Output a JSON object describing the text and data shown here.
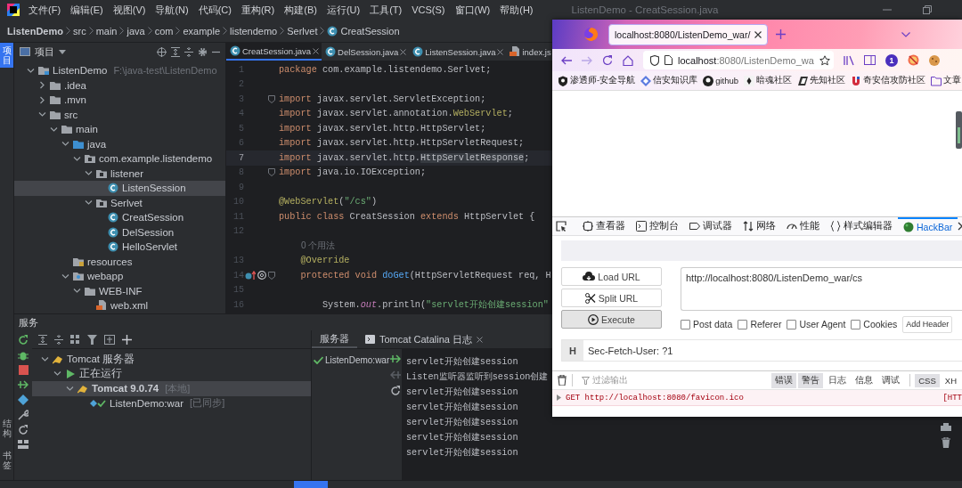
{
  "ide": {
    "title": "ListenDemo - CreatSession.java",
    "menu": [
      "文件(F)",
      "编辑(E)",
      "视图(V)",
      "导航(N)",
      "代码(C)",
      "重构(R)",
      "构建(B)",
      "运行(U)",
      "工具(T)",
      "VCS(S)",
      "窗口(W)",
      "帮助(H)"
    ],
    "breadcrumb": [
      {
        "label": "ListenDemo",
        "kind": "project"
      },
      {
        "label": "src",
        "kind": "folder"
      },
      {
        "label": "main",
        "kind": "folder"
      },
      {
        "label": "java",
        "kind": "folder"
      },
      {
        "label": "com",
        "kind": "folder"
      },
      {
        "label": "example",
        "kind": "folder"
      },
      {
        "label": "listendemo",
        "kind": "folder"
      },
      {
        "label": "Serlvet",
        "kind": "folder"
      },
      {
        "label": "CreatSession",
        "kind": "class"
      }
    ],
    "left_stripe": [
      {
        "label": "项目",
        "selected": true,
        "kind": "top"
      },
      {
        "label": "结构",
        "selected": false,
        "kind": "bottom"
      },
      {
        "label": "书签",
        "selected": false,
        "kind": "bottom"
      }
    ],
    "project_panel": {
      "title": "项目",
      "tree": [
        {
          "label": "ListenDemo",
          "note": "F:\\java-test\\ListenDemo",
          "kind": "module",
          "expanded": true,
          "selected": false,
          "children": [
            {
              "label": ".idea",
              "kind": "folder",
              "expanded": false,
              "selected": false
            },
            {
              "label": ".mvn",
              "kind": "folder",
              "expanded": false,
              "selected": false
            },
            {
              "label": "src",
              "kind": "folder",
              "expanded": true,
              "selected": false,
              "children": [
                {
                  "label": "main",
                  "kind": "folder",
                  "expanded": true,
                  "selected": false,
                  "children": [
                    {
                      "label": "java",
                      "kind": "source",
                      "expanded": true,
                      "selected": false,
                      "children": [
                        {
                          "label": "com.example.listendemo",
                          "kind": "package",
                          "expanded": true,
                          "selected": false,
                          "children": [
                            {
                              "label": "listener",
                              "kind": "package",
                              "expanded": true,
                              "selected": false,
                              "children": [
                                {
                                  "label": "ListenSession",
                                  "kind": "class",
                                  "selected": true
                                }
                              ]
                            },
                            {
                              "label": "Serlvet",
                              "kind": "package",
                              "expanded": true,
                              "selected": false,
                              "children": [
                                {
                                  "label": "CreatSession",
                                  "kind": "class",
                                  "selected": false
                                },
                                {
                                  "label": "DelSession",
                                  "kind": "class",
                                  "selected": false
                                },
                                {
                                  "label": "HelloServlet",
                                  "kind": "class",
                                  "selected": false
                                }
                              ]
                            }
                          ]
                        }
                      ]
                    },
                    {
                      "label": "resources",
                      "kind": "resources",
                      "selected": false
                    },
                    {
                      "label": "webapp",
                      "kind": "web",
                      "expanded": true,
                      "selected": false,
                      "children": [
                        {
                          "label": "WEB-INF",
                          "kind": "folder",
                          "expanded": true,
                          "selected": false,
                          "children": [
                            {
                              "label": "web.xml",
                              "kind": "xml",
                              "selected": false
                            }
                          ]
                        }
                      ]
                    }
                  ]
                }
              ]
            }
          ]
        }
      ]
    },
    "editor": {
      "tabs": [
        {
          "label": "CreatSession.java",
          "kind": "class",
          "selected": true,
          "closable": true
        },
        {
          "label": "DelSession.java",
          "kind": "class",
          "selected": false,
          "closable": true
        },
        {
          "label": "ListenSession.java",
          "kind": "class",
          "selected": false,
          "closable": true
        },
        {
          "label": "index.js",
          "kind": "jsp",
          "selected": false,
          "closable": false
        }
      ],
      "lines": [
        {
          "kind": "code",
          "number": "1",
          "current": false,
          "fold": false,
          "override": false,
          "tokens": [
            {
              "kind": "kw",
              "text": "package "
            },
            {
              "kind": "plain",
              "text": "com.example.listendemo.Serlvet;"
            }
          ]
        },
        {
          "kind": "code",
          "number": "2",
          "current": false,
          "fold": false,
          "override": false
        },
        {
          "kind": "code",
          "number": "3",
          "current": false,
          "fold": true,
          "override": false,
          "tokens": [
            {
              "kind": "kw",
              "text": "import "
            },
            {
              "kind": "plain",
              "text": "javax.servlet.ServletException;"
            }
          ]
        },
        {
          "kind": "code",
          "number": "4",
          "current": false,
          "fold": false,
          "override": false,
          "tokens": [
            {
              "kind": "kw",
              "text": "import "
            },
            {
              "kind": "plain",
              "text": "javax.servlet.annotation."
            },
            {
              "kind": "ann",
              "text": "WebServlet"
            },
            {
              "kind": "plain",
              "text": ";"
            }
          ]
        },
        {
          "kind": "code",
          "number": "5",
          "current": false,
          "fold": false,
          "override": false,
          "tokens": [
            {
              "kind": "kw",
              "text": "import "
            },
            {
              "kind": "plain",
              "text": "javax.servlet.http.HttpServlet;"
            }
          ]
        },
        {
          "kind": "code",
          "number": "6",
          "current": false,
          "fold": false,
          "override": false,
          "tokens": [
            {
              "kind": "kw",
              "text": "import "
            },
            {
              "kind": "plain",
              "text": "javax.servlet.http.HttpServletRequest;"
            }
          ]
        },
        {
          "kind": "code",
          "number": "7",
          "current": true,
          "fold": false,
          "override": false,
          "tokens": [
            {
              "kind": "kw",
              "text": "import "
            },
            {
              "kind": "plain",
              "text": "javax.servlet.http."
            },
            {
              "kind": "hl",
              "text": "HttpServletResponse"
            },
            {
              "kind": "plain",
              "text": ";"
            }
          ]
        },
        {
          "kind": "code",
          "number": "8",
          "current": false,
          "fold": true,
          "override": false,
          "tokens": [
            {
              "kind": "kw",
              "text": "import "
            },
            {
              "kind": "plain",
              "text": "java.io.IOException;"
            }
          ]
        },
        {
          "kind": "code",
          "number": "9",
          "current": false,
          "fold": false,
          "override": false
        },
        {
          "kind": "code",
          "number": "10",
          "current": false,
          "fold": false,
          "override": false,
          "tokens": [
            {
              "kind": "ann",
              "text": "@WebServlet"
            },
            {
              "kind": "plain",
              "text": "("
            },
            {
              "kind": "str",
              "text": "\"/cs\""
            },
            {
              "kind": "plain",
              "text": ")"
            }
          ]
        },
        {
          "kind": "code",
          "number": "11",
          "current": false,
          "fold": false,
          "override": false,
          "tokens": [
            {
              "kind": "kw",
              "text": "public class "
            },
            {
              "kind": "plain",
              "text": "CreatSession "
            },
            {
              "kind": "kw",
              "text": "extends "
            },
            {
              "kind": "plain",
              "text": "HttpServlet {"
            }
          ]
        },
        {
          "kind": "code",
          "number": "12",
          "current": false,
          "fold": false,
          "override": false
        },
        {
          "kind": "hint",
          "text": "0 个用法"
        },
        {
          "kind": "code",
          "number": "13",
          "current": false,
          "fold": false,
          "override": false,
          "tokens": [
            {
              "kind": "ann",
              "text": "    @Override"
            }
          ]
        },
        {
          "kind": "code",
          "number": "14",
          "current": false,
          "fold": true,
          "override": true,
          "tokens": [
            {
              "kind": "kw",
              "text": "    protected void "
            },
            {
              "kind": "method",
              "text": "doGet"
            },
            {
              "kind": "plain",
              "text": "(HttpServletRequest req, H"
            }
          ]
        },
        {
          "kind": "code",
          "number": "15",
          "current": false,
          "fold": false,
          "override": false
        },
        {
          "kind": "code",
          "number": "16",
          "current": false,
          "fold": false,
          "override": false,
          "tokens": [
            {
              "kind": "plain",
              "text": "        System."
            },
            {
              "kind": "field",
              "text": "out"
            },
            {
              "kind": "plain",
              "text": ".println("
            },
            {
              "kind": "str",
              "text": "\"servlet开始创建session\""
            }
          ]
        }
      ]
    },
    "services": {
      "title": "服务",
      "tree": [
        {
          "label": "Tomcat 服务器",
          "kind": "server",
          "expanded": true,
          "selected": false,
          "children": [
            {
              "label": "正在运行",
              "kind": "running",
              "expanded": true,
              "selected": false,
              "children": [
                {
                  "label": "Tomcat 9.0.74",
                  "note": "[本地]",
                  "kind": "tomcat",
                  "expanded": true,
                  "selected": true,
                  "children": [
                    {
                      "label": "ListenDemo:war",
                      "note": "[已同步]",
                      "kind": "artifact",
                      "selected": false
                    }
                  ]
                }
              ]
            }
          ]
        }
      ],
      "tabs": [
        {
          "label": "服务器",
          "kind": "plain",
          "selected": true
        },
        {
          "label": "Tomcat Catalina 日志",
          "kind": "log",
          "selected": false
        }
      ],
      "deployments": [
        {
          "label": "ListenDemo:war",
          "ok": true
        }
      ],
      "console": [
        "servlet开始创建session",
        "Listen监听器监听到session创建",
        "servlet开始创建session",
        "servlet开始创建session",
        "servlet开始创建session",
        "servlet开始创建session",
        "servlet开始创建session"
      ]
    }
  },
  "browser": {
    "tabs": [
      {
        "title": "localhost:8080/ListenDemo_war/",
        "selected": true
      }
    ],
    "address": {
      "host": "localhost",
      "rest": ":8080/ListenDemo_wa"
    },
    "extension_badge": "1",
    "bookmarks": [
      {
        "label": "渗透师-安全导航",
        "kind": "shield"
      },
      {
        "label": "信安知识库",
        "kind": "diamond"
      },
      {
        "label": "github",
        "kind": "cat"
      },
      {
        "label": "暗魂社区",
        "kind": "dot"
      },
      {
        "label": "先知社区",
        "kind": "flag"
      },
      {
        "label": "奇安信攻防社区",
        "kind": "magnet"
      },
      {
        "label": "文章",
        "kind": "folder"
      }
    ],
    "devtools": {
      "tabs": [
        {
          "label": "查看器",
          "kind": "inspector",
          "selected": false
        },
        {
          "label": "控制台",
          "kind": "console",
          "selected": false
        },
        {
          "label": "调试器",
          "kind": "debugger",
          "selected": false
        },
        {
          "label": "网络",
          "kind": "network",
          "selected": false
        },
        {
          "label": "性能",
          "kind": "performance",
          "selected": false
        },
        {
          "label": "样式编辑器",
          "kind": "style",
          "selected": false
        },
        {
          "label": "HackBar",
          "kind": "hackbar",
          "selected": true
        }
      ],
      "hackbar": {
        "buttons": [
          {
            "label": "Load URL",
            "kind": "load",
            "selected": false
          },
          {
            "label": "Split URL",
            "kind": "split",
            "selected": false
          },
          {
            "label": "Execute",
            "kind": "execute",
            "selected": true
          }
        ],
        "url": "http://localhost:8080/ListenDemo_war/cs",
        "options": [
          {
            "label": "Post data",
            "checked": false
          },
          {
            "label": "Referer",
            "checked": false
          },
          {
            "label": "User Agent",
            "checked": false
          },
          {
            "label": "Cookies",
            "checked": false
          }
        ],
        "add_header": "Add Header",
        "headers": [
          {
            "key": "H",
            "value": "Sec-Fetch-User: ?1"
          }
        ]
      },
      "console": {
        "filter_placeholder": "过滤输出",
        "levels": [
          {
            "label": "错误",
            "on": true
          },
          {
            "label": "警告",
            "on": true
          },
          {
            "label": "日志",
            "on": false
          },
          {
            "label": "信息",
            "on": false
          },
          {
            "label": "调试",
            "on": false
          },
          {
            "label": "CSS",
            "on": true
          },
          {
            "label": "XH",
            "on": false
          }
        ],
        "messages": [
          {
            "kind": "error",
            "text": "GET http://localhost:8080/favicon.ico",
            "status": "[HTT"
          }
        ]
      }
    }
  }
}
